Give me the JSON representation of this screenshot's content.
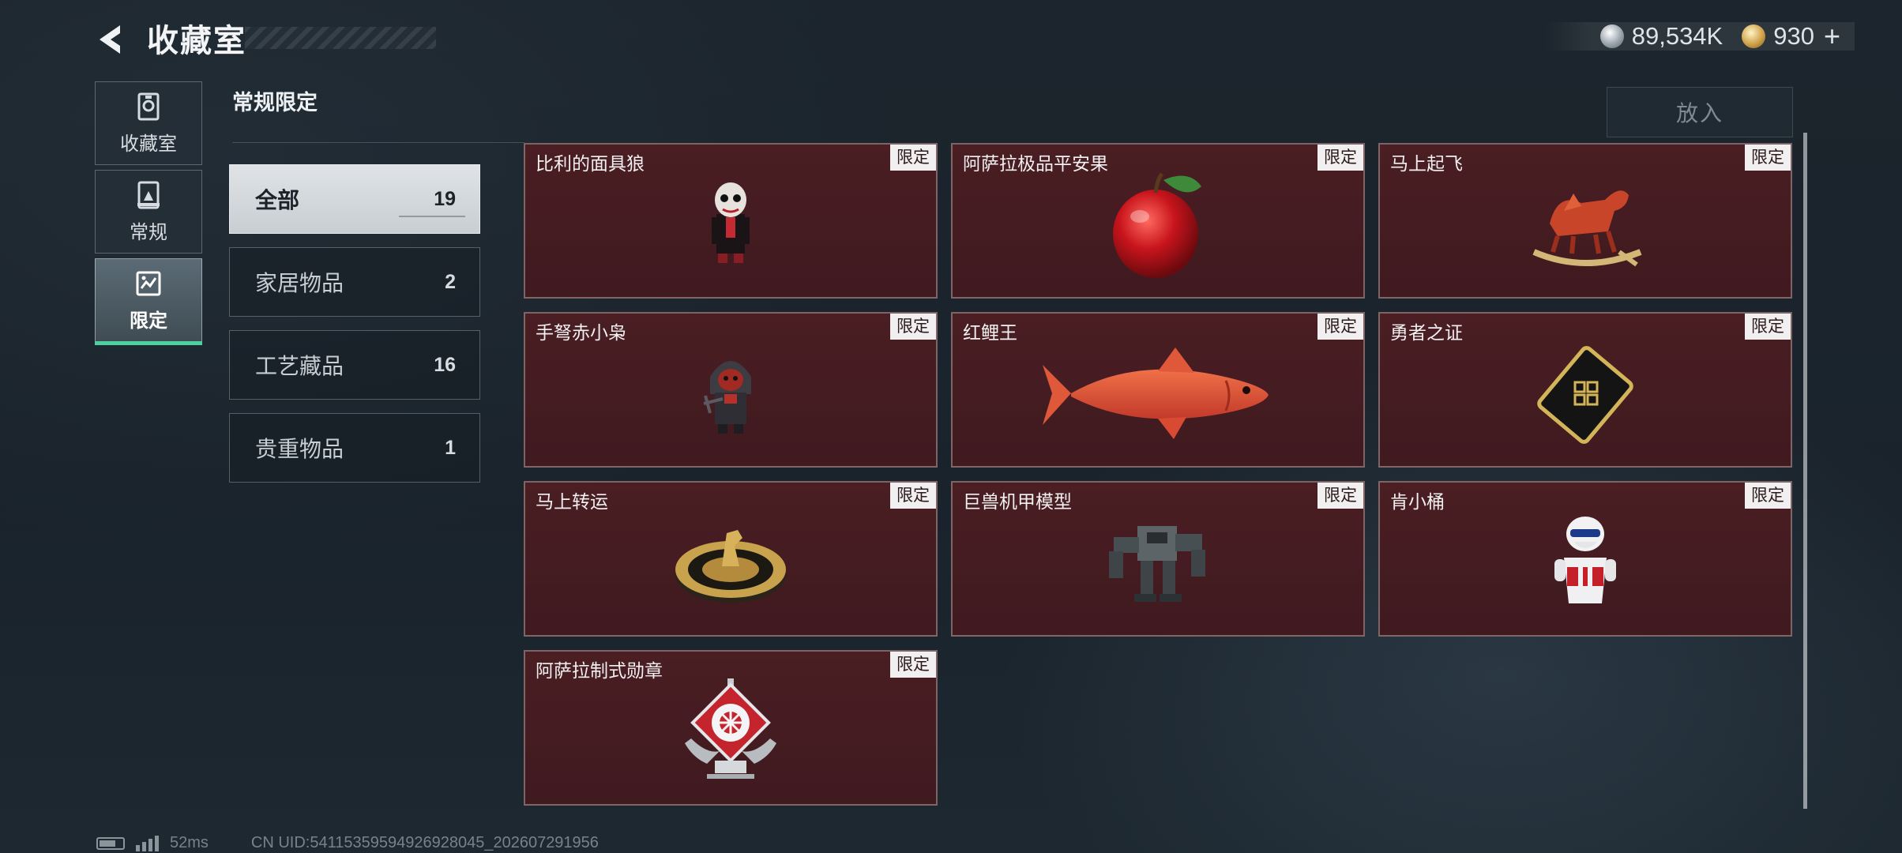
{
  "header": {
    "title": "收藏室"
  },
  "currency": {
    "silver": "89,534K",
    "gold": "930",
    "plus": "+"
  },
  "rail": [
    {
      "label": "收藏室",
      "icon": "collection-room-icon"
    },
    {
      "label": "常规",
      "icon": "regular-icon"
    },
    {
      "label": "限定",
      "icon": "limited-icon",
      "active": true
    }
  ],
  "section_title": "常规限定",
  "categories": [
    {
      "label": "全部",
      "count": "19",
      "active": true
    },
    {
      "label": "家居物品",
      "count": "2"
    },
    {
      "label": "工艺藏品",
      "count": "16"
    },
    {
      "label": "贵重物品",
      "count": "1"
    }
  ],
  "place_button": "放入",
  "items": [
    {
      "name": "比利的面具狼",
      "badge": "限定",
      "icon": "billy-mask-figure-icon"
    },
    {
      "name": "阿萨拉极品平安果",
      "badge": "限定",
      "icon": "red-apple-icon"
    },
    {
      "name": "马上起飞",
      "badge": "限定",
      "icon": "rocking-horse-icon"
    },
    {
      "name": "手弩赤小枭",
      "badge": "限定",
      "icon": "hooded-crossbow-figure-icon"
    },
    {
      "name": "红鲤王",
      "badge": "限定",
      "icon": "red-carp-icon"
    },
    {
      "name": "勇者之证",
      "badge": "限定",
      "icon": "gold-card-icon"
    },
    {
      "name": "马上转运",
      "badge": "限定",
      "icon": "horse-compass-icon"
    },
    {
      "name": "巨兽机甲模型",
      "badge": "限定",
      "icon": "mech-model-icon"
    },
    {
      "name": "肯小桶",
      "badge": "限定",
      "icon": "bucket-figure-icon"
    },
    {
      "name": "阿萨拉制式勋章",
      "badge": "限定",
      "icon": "medal-icon"
    }
  ],
  "footer": {
    "ping": "52ms",
    "uid": "CN UID:54115359594926928045_202607291956"
  },
  "colors": {
    "accent": "#4ed1a0",
    "card_bg": "#451c21",
    "badge_bg": "#f1efef"
  }
}
